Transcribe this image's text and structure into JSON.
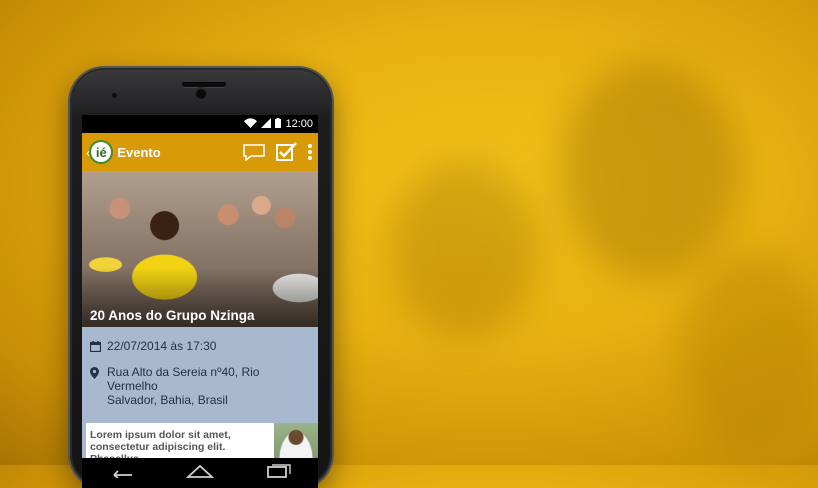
{
  "status_bar": {
    "time": "12:00"
  },
  "app_bar": {
    "logo_text": "ié",
    "title": "Evento",
    "actions": [
      "chat-bubble-icon",
      "check-box-icon",
      "overflow-menu-icon"
    ]
  },
  "event": {
    "title": "20 Anos do Grupo Nzinga",
    "datetime": "22/07/2014 às 17:30",
    "address_line1": "Rua Alto da Sereia nº40, Rio Vermelho",
    "address_line2": "Salvador, Bahia, Brasil"
  },
  "card": {
    "line1": "Lorem ipsum dolor sit amet,",
    "line2": "consectetur adipiscing elit. Phasellus"
  },
  "colors": {
    "app_bar": "#d99a08",
    "details_bg": "#a8b9cf",
    "background": "#e8b010"
  }
}
